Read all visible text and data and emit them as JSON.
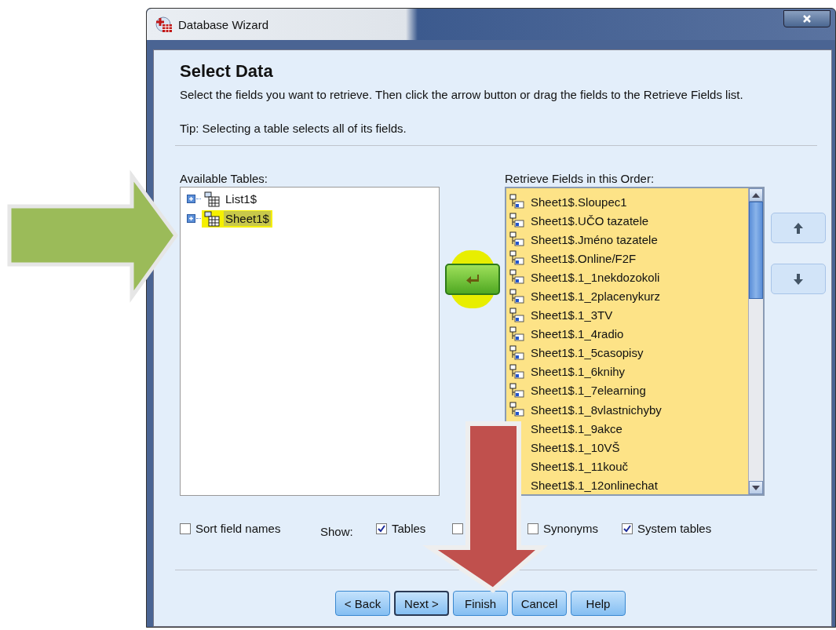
{
  "window": {
    "title": "Database Wizard"
  },
  "heading": "Select Data",
  "description": "Select the fields you want to retrieve. Then click the arrow button or drag the fields to the Retrieve Fields list.",
  "tip": "Tip: Selecting a table selects all of its fields.",
  "available_tables": {
    "label": "Available Tables:",
    "items": [
      {
        "name": "List1$",
        "selected": false,
        "highlighted": false,
        "expanded": false
      },
      {
        "name": "Sheet1$",
        "selected": true,
        "highlighted": true,
        "expanded": false
      }
    ]
  },
  "add_button": {
    "highlighted": true
  },
  "retrieve_fields": {
    "label": "Retrieve Fields in this Order:",
    "items": [
      {
        "label": "Sheet1$.Sloupec1"
      },
      {
        "label": "Sheet1$.UČO tazatele"
      },
      {
        "label": "Sheet1$.Jméno tazatele"
      },
      {
        "label": "Sheet1$.Online/F2F"
      },
      {
        "label": "Sheet1$.1_1nekdozokoli"
      },
      {
        "label": "Sheet1$.1_2placenykurz"
      },
      {
        "label": "Sheet1$.1_3TV"
      },
      {
        "label": "Sheet1$.1_4radio"
      },
      {
        "label": "Sheet1$.1_5casopisy"
      },
      {
        "label": "Sheet1$.1_6knihy"
      },
      {
        "label": "Sheet1$.1_7elearning"
      },
      {
        "label": "Sheet1$.1_8vlastnichyby"
      },
      {
        "label": "Sheet1$.1_9akce"
      },
      {
        "label": "Sheet1$.1_10VŠ"
      },
      {
        "label": "Sheet1$.1_11kouč"
      },
      {
        "label": "Sheet1$.1_12onlinechat"
      }
    ]
  },
  "sort_option": {
    "label": "Sort field names",
    "checked": false
  },
  "show": {
    "label": "Show:",
    "options": [
      {
        "label": "Tables",
        "checked": true
      },
      {
        "checked": false
      },
      {
        "label": "Synonyms",
        "checked": false
      },
      {
        "label": "System tables",
        "checked": true
      }
    ]
  },
  "buttons": [
    {
      "label": "< Back",
      "default": false
    },
    {
      "label": "Next >",
      "default": true
    },
    {
      "label": "Finish",
      "default": false
    },
    {
      "label": "Cancel",
      "default": false
    },
    {
      "label": "Help",
      "default": false
    }
  ],
  "annotations": [
    {
      "kind": "arrow-right",
      "color": "#9bbb59"
    },
    {
      "kind": "arrow-down",
      "color": "#c0504d"
    }
  ]
}
